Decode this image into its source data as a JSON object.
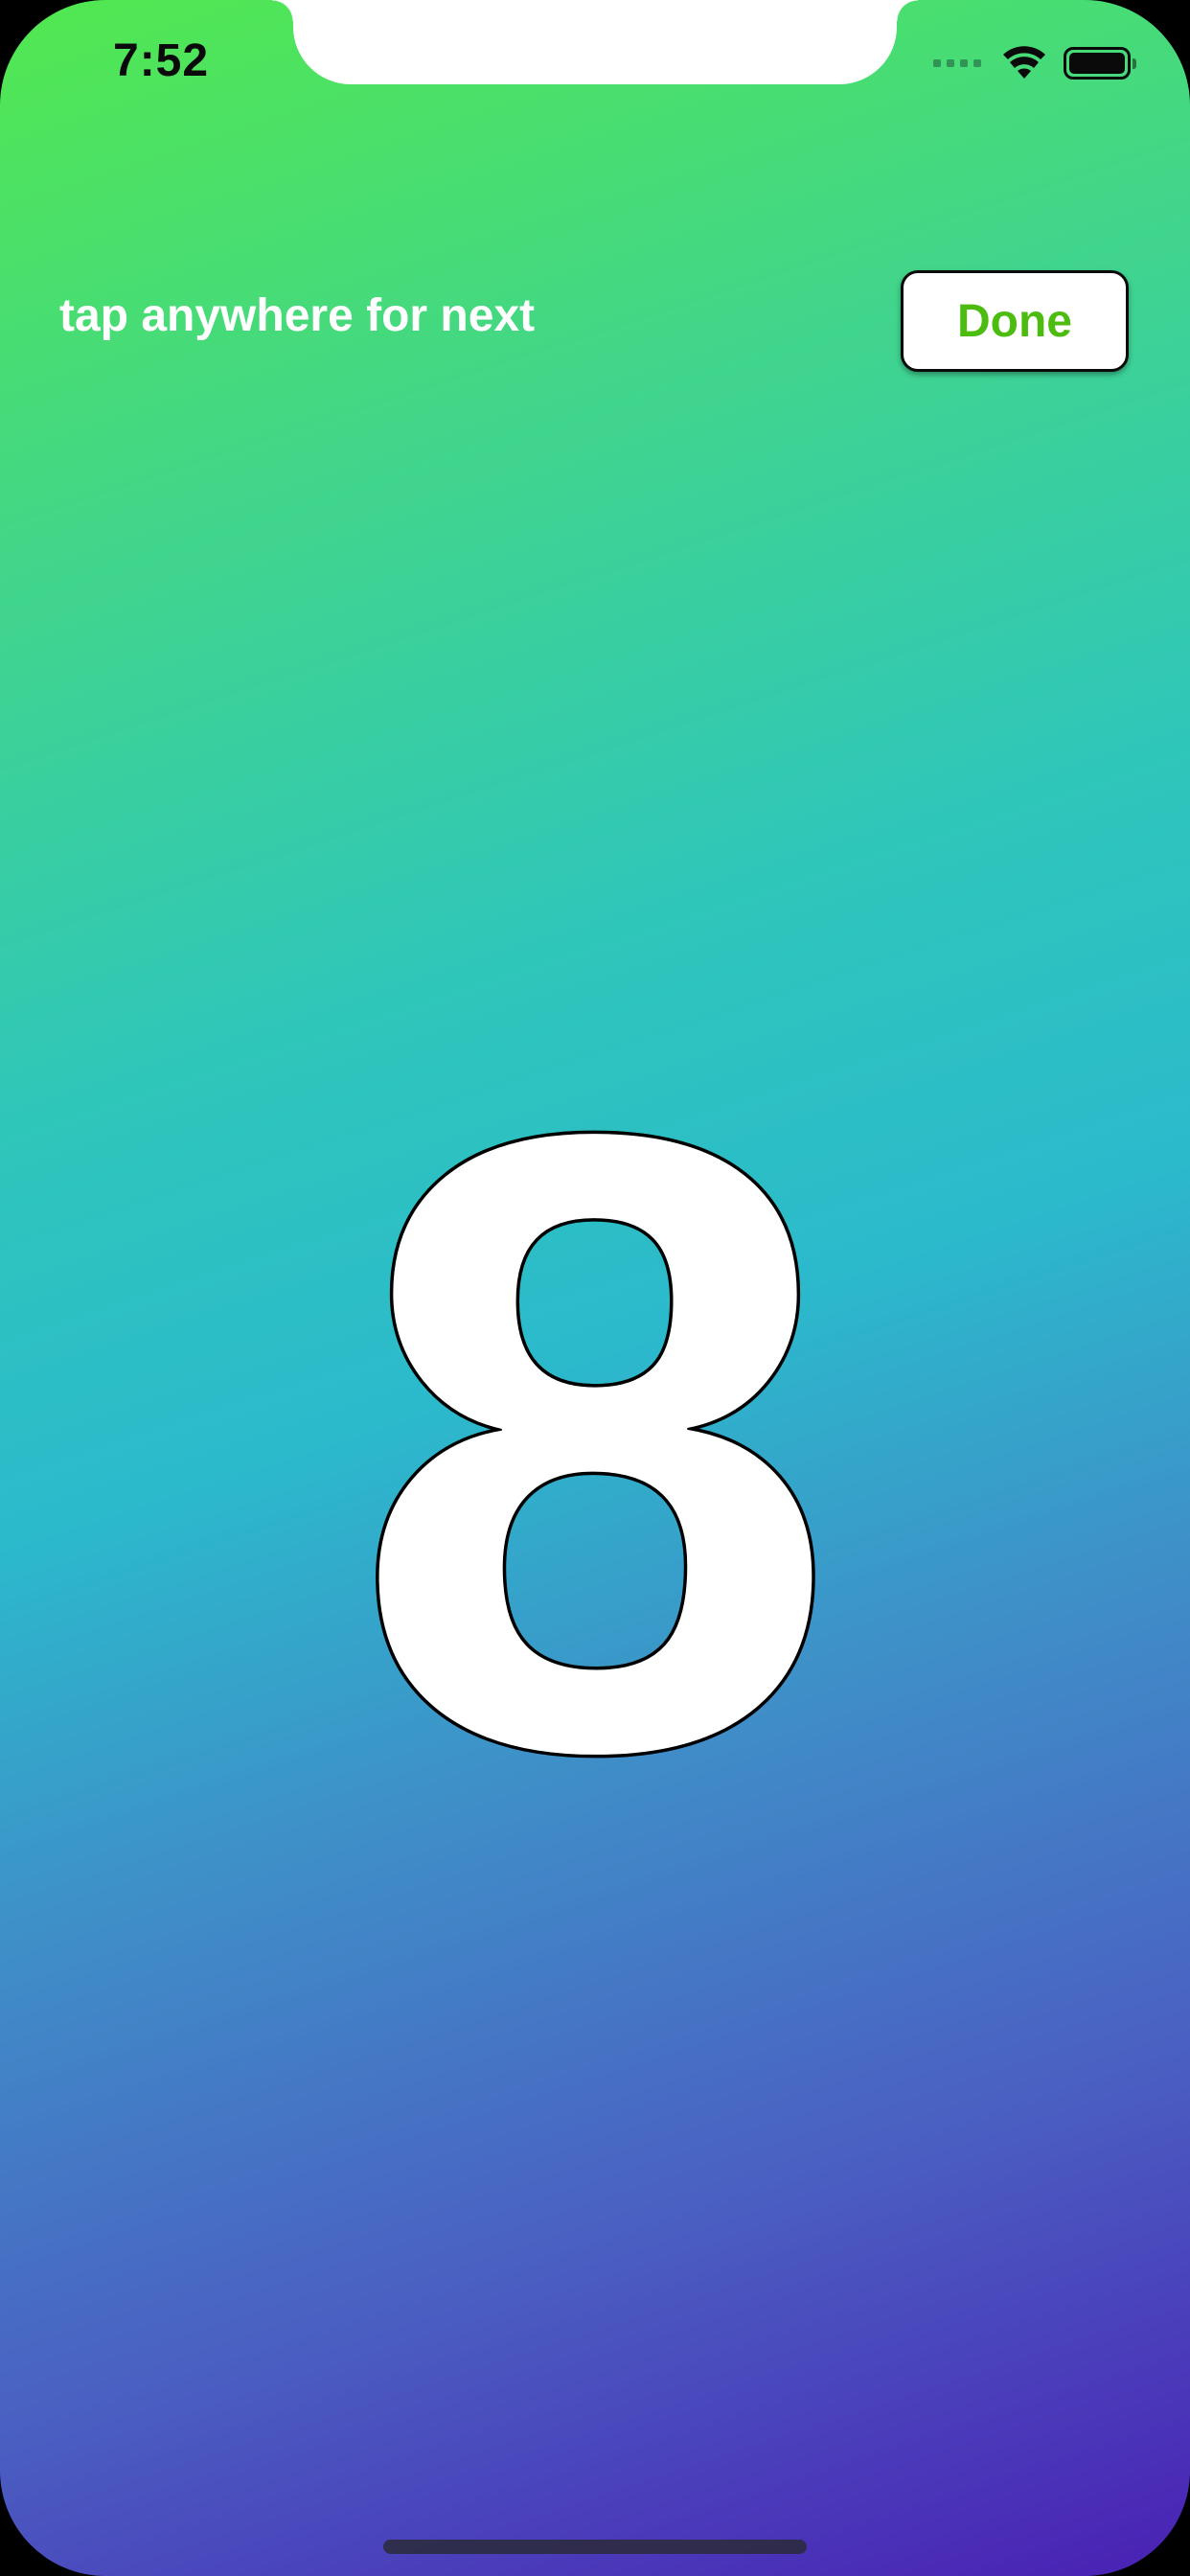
{
  "status_bar": {
    "time": "7:52",
    "wifi_icon": "wifi-icon",
    "battery_icon": "battery-icon",
    "signal_icon": "cellular-signal-icon"
  },
  "header": {
    "hint": "tap anywhere for next",
    "done_label": "Done"
  },
  "main": {
    "number": "8"
  },
  "colors": {
    "accent_green": "#4cbd10",
    "gradient_top": "#52e84f",
    "gradient_mid": "#2bbacc",
    "gradient_bottom": "#4a20b4"
  }
}
